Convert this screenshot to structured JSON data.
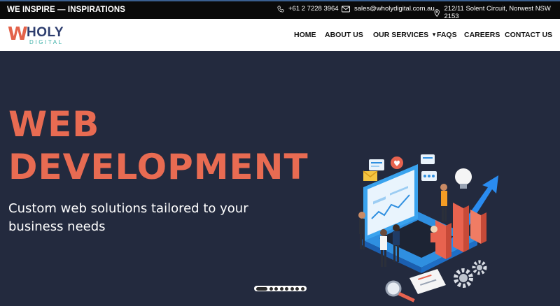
{
  "topbar": {
    "tagline": "WE INSPIRE — INSPIRATIONS",
    "phone": "+61 2 7228 3964",
    "email": "sales@wholydigital.com.au",
    "address": "212/11 Solent Circuit, Norwest NSW 2153"
  },
  "logo": {
    "mark": "W",
    "name": "HOLY",
    "sub": "DIGITAL"
  },
  "nav": {
    "home": "HOME",
    "about": "ABOUT US",
    "services": "OUR SERVICES",
    "faqs": "FAQS",
    "careers": "CAREERS",
    "contact": "CONTACT US"
  },
  "hero": {
    "line1": "WEB",
    "line2": "DEVELOPMENT",
    "subtitle": "Custom web solutions tailored to your business needs",
    "illustration": "web-development-isometric-illustration"
  },
  "slider": {
    "dot_count": 8,
    "active_index": 0
  },
  "colors": {
    "accent": "#e86b52",
    "hero_bg": "#232a3e",
    "topbar_bg": "#0a0a0a",
    "logo_navy": "#2d3d6e",
    "logo_teal": "#3bb0a8"
  }
}
